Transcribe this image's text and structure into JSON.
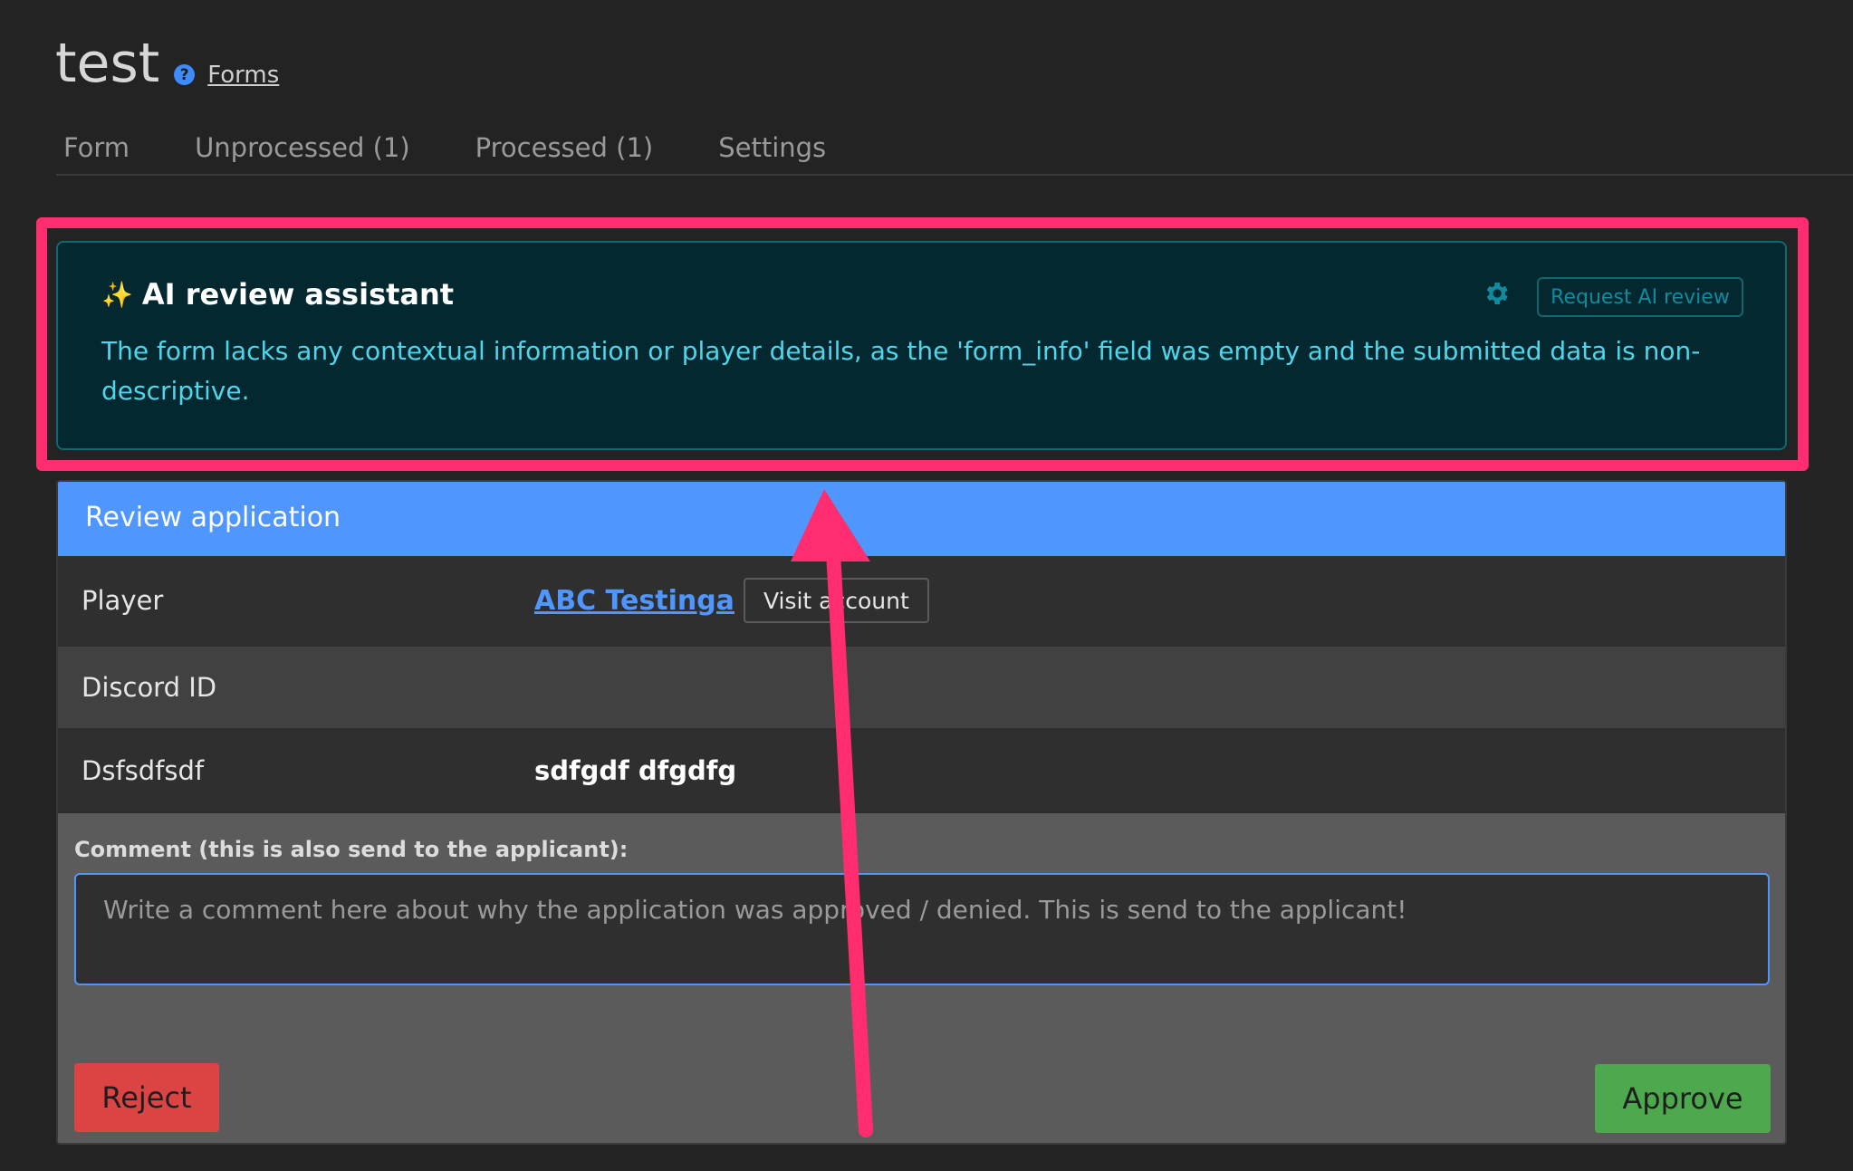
{
  "header": {
    "title": "test",
    "help_icon": "question-circle-icon",
    "help_glyph": "?",
    "forms_link": "Forms"
  },
  "tabs": [
    {
      "label": "Form"
    },
    {
      "label": "Unprocessed (1)"
    },
    {
      "label": "Processed (1)"
    },
    {
      "label": "Settings"
    }
  ],
  "ai_review": {
    "sparkle_icon": "sparkles-icon",
    "sparkle_glyph": "✨",
    "title": "AI review assistant",
    "text": "The form lacks any contextual information or player details, as the 'form_info' field was empty and the submitted data is non-descriptive.",
    "settings_icon": "gear-icon",
    "request_button": "Request AI review"
  },
  "review": {
    "header": "Review application",
    "rows": [
      {
        "label": "Player",
        "link": "ABC Testinga",
        "button": "Visit account"
      },
      {
        "label": "Discord ID",
        "value": ""
      },
      {
        "label": "Dsfsdfsdf",
        "value": "sdfgdf dfgdfg"
      }
    ],
    "comment_label": "Comment (this is also send to the applicant):",
    "comment_placeholder": "Write a comment here about why the application was approved / denied. This is send to the applicant!",
    "reject_button": "Reject",
    "approve_button": "Approve"
  },
  "colors": {
    "background": "#232323",
    "accent_blue": "#4f96ff",
    "ai_panel_bg": "#032830",
    "ai_text": "#4fd6ea",
    "highlight": "#ff2d6f",
    "reject": "#dc4444",
    "approve": "#4ea94e"
  }
}
